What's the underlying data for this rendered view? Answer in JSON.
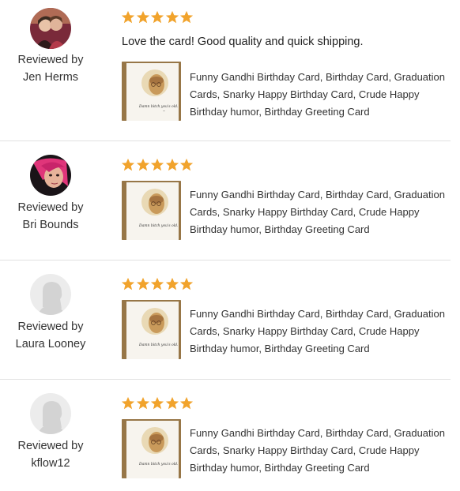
{
  "colors": {
    "star": "#F1A32C",
    "divider": "#E1E1E1",
    "text": "#222222"
  },
  "reviews": [
    {
      "reviewed_by": "Reviewed by",
      "reviewer": "Jen Herms",
      "rating": 5,
      "text": "Love the card! Good quality and quick shipping.",
      "product_title": "Funny Gandhi Birthday Card, Birthday Card, Graduation Cards, Snarky Happy Birthday Card, Crude Happy Birthday humor, Birthday Greeting Card",
      "avatar_icon": "photo-avatar-couple"
    },
    {
      "reviewed_by": "Reviewed by",
      "reviewer": "Bri Bounds",
      "rating": 5,
      "text": "",
      "product_title": "Funny Gandhi Birthday Card, Birthday Card, Graduation Cards, Snarky Happy Birthday Card, Crude Happy Birthday humor, Birthday Greeting Card",
      "avatar_icon": "photo-avatar-pink-hair"
    },
    {
      "reviewed_by": "Reviewed by",
      "reviewer": "Laura Looney",
      "rating": 5,
      "text": "",
      "product_title": "Funny Gandhi Birthday Card, Birthday Card, Graduation Cards, Snarky Happy Birthday Card, Crude Happy Birthday humor, Birthday Greeting Card",
      "avatar_icon": "default-avatar"
    },
    {
      "reviewed_by": "Reviewed by",
      "reviewer": "kflow12",
      "rating": 5,
      "text": "",
      "product_title": "Funny Gandhi Birthday Card, Birthday Card, Graduation Cards, Snarky Happy Birthday Card, Crude Happy Birthday humor, Birthday Greeting Card",
      "avatar_icon": "default-avatar"
    }
  ],
  "card_caption": "Damn bitch you's old."
}
